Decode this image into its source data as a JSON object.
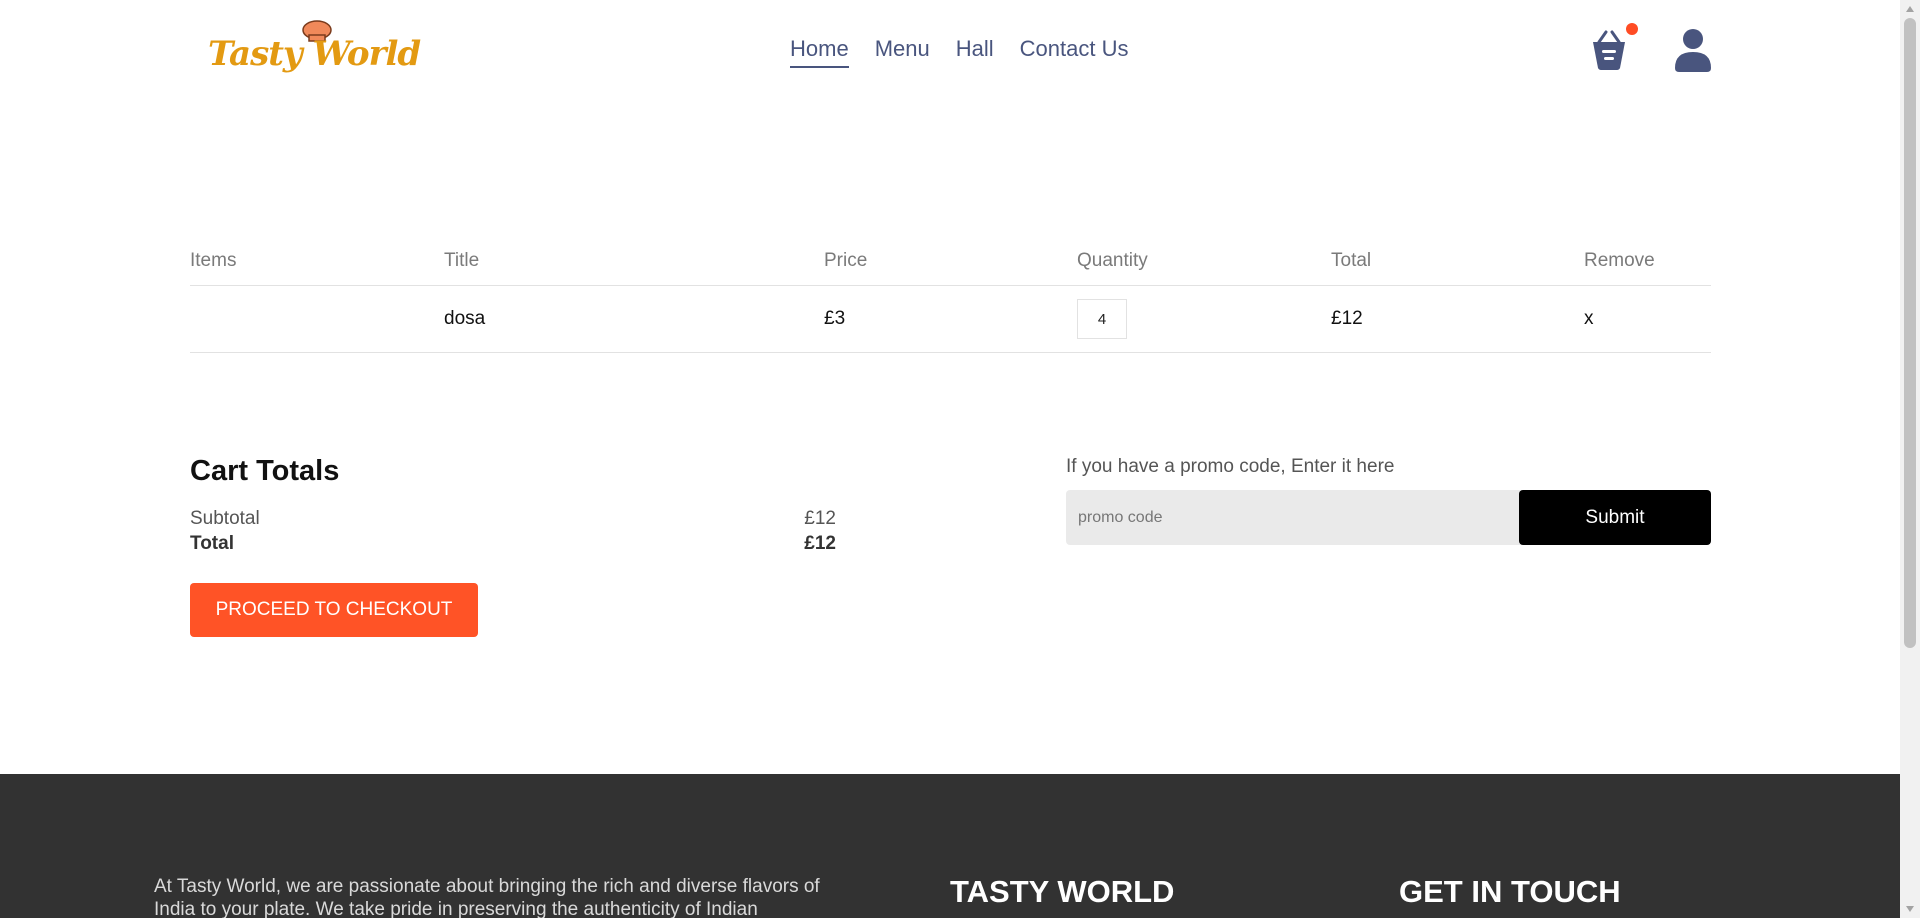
{
  "header": {
    "logo_text": "Tasty World",
    "nav": [
      "Home",
      "Menu",
      "Hall",
      "Contact Us"
    ],
    "active_nav": "Home",
    "cart_icon": "basket-icon",
    "user_icon": "user-icon"
  },
  "cart": {
    "columns": [
      "Items",
      "Title",
      "Price",
      "Quantity",
      "Total",
      "Remove"
    ],
    "rows": [
      {
        "image": "",
        "title": "dosa",
        "price": "£3",
        "quantity": "4",
        "total": "£12",
        "remove": "x"
      }
    ]
  },
  "totals": {
    "heading": "Cart Totals",
    "subtotal_label": "Subtotal",
    "subtotal_value": "£12",
    "total_label": "Total",
    "total_value": "£12",
    "checkout_label": "PROCEED TO CHECKOUT"
  },
  "promo": {
    "label": "If you have a promo code, Enter it here",
    "placeholder": "promo code",
    "submit_label": "Submit"
  },
  "footer": {
    "about_text": "At Tasty World, we are passionate about bringing the rich and diverse flavors of India to your plate. We take pride in preserving the authenticity of Indian",
    "brand_heading": "TASTY WORLD",
    "contact_heading": "GET IN TOUCH"
  },
  "colors": {
    "accent": "#ff5326",
    "nav": "#49557e",
    "logo": "#e39a12",
    "footer_bg": "#323232"
  }
}
